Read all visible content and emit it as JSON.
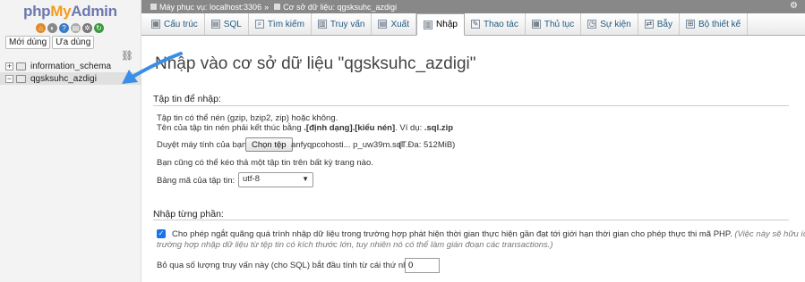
{
  "logo": {
    "php": "php",
    "my": "My",
    "admin": "Admin"
  },
  "nav": {
    "recent_label": "Mới dùng",
    "favorites_label": "Ưa dùng",
    "databases": [
      {
        "name": "information_schema",
        "expander": "+"
      },
      {
        "name": "qgsksuhc_azdigi",
        "expander": "−"
      }
    ]
  },
  "breadcrumb": {
    "server": "Máy phục vụ: localhost:3306",
    "separator": "»",
    "database": "Cơ sở dữ liệu: qgsksuhc_azdigi"
  },
  "tabs": [
    {
      "label": "Cấu trúc",
      "icon": "structure-icon"
    },
    {
      "label": "SQL",
      "icon": "sql-icon"
    },
    {
      "label": "Tìm kiếm",
      "icon": "search-icon"
    },
    {
      "label": "Truy vấn",
      "icon": "query-icon"
    },
    {
      "label": "Xuất",
      "icon": "export-icon"
    },
    {
      "label": "Nhập",
      "icon": "import-icon",
      "active": true
    },
    {
      "label": "Thao tác",
      "icon": "operations-icon"
    },
    {
      "label": "Thủ tục",
      "icon": "routines-icon"
    },
    {
      "label": "Sự kiện",
      "icon": "events-icon"
    },
    {
      "label": "Bẫy",
      "icon": "triggers-icon"
    },
    {
      "label": "Bộ thiết kế",
      "icon": "designer-icon"
    }
  ],
  "main": {
    "title": "Nhập vào cơ sở dữ liệu \"qgsksuhc_azdigi\"",
    "file_section": {
      "heading": "Tập tin để nhập:",
      "compress_note": "Tập tin có thể nén (gzip, bzip2, zip) hoặc không.",
      "name_note_prefix": "Tên của tập tin nén phải kết thúc bằng ",
      "name_note_format": ".[định dạng].[kiểu nén]",
      "name_note_example": ". Ví dụ: ",
      "name_note_ext": ".sql.zip",
      "browse_label": "Duyệt máy tính của bạn:",
      "choose_button": "Chọn tệp",
      "chosen_file": "anfyqpcohosti... p_uw39m.sql",
      "max_size": "(T.Đa: 512MiB)",
      "drag_note": "Bạn cũng có thể kéo thả một tập tin trên bất kỳ trang nào.",
      "charset_label": "Bảng mã của tập tin:",
      "charset_value": "utf-8"
    },
    "partial_section": {
      "heading": "Nhập từng phần:",
      "allow_interrupt": "Cho phép ngắt quãng quá trình nhập dữ liệu trong trường hợp phát hiện thời gian thực hiện gần đạt tới giới hạn thời gian cho phép thực thi mã PHP.",
      "allow_interrupt_hint_1": "(Việc này sẽ hữu ích trong",
      "allow_interrupt_hint_2": "trường hợp nhập dữ liệu từ tệp tin có kích thước lớn, tuy nhiên nó có thể làm gián đoạn các transactions.)",
      "skip_label": "Bỏ qua số lượng truy vấn này (cho SQL) bắt đầu tính từ cái thứ nhất:",
      "skip_value": "0"
    }
  },
  "colors": {
    "accent": "#1a73e8",
    "link": "#235a81",
    "annotation_arrow": "#3a8ee6"
  }
}
